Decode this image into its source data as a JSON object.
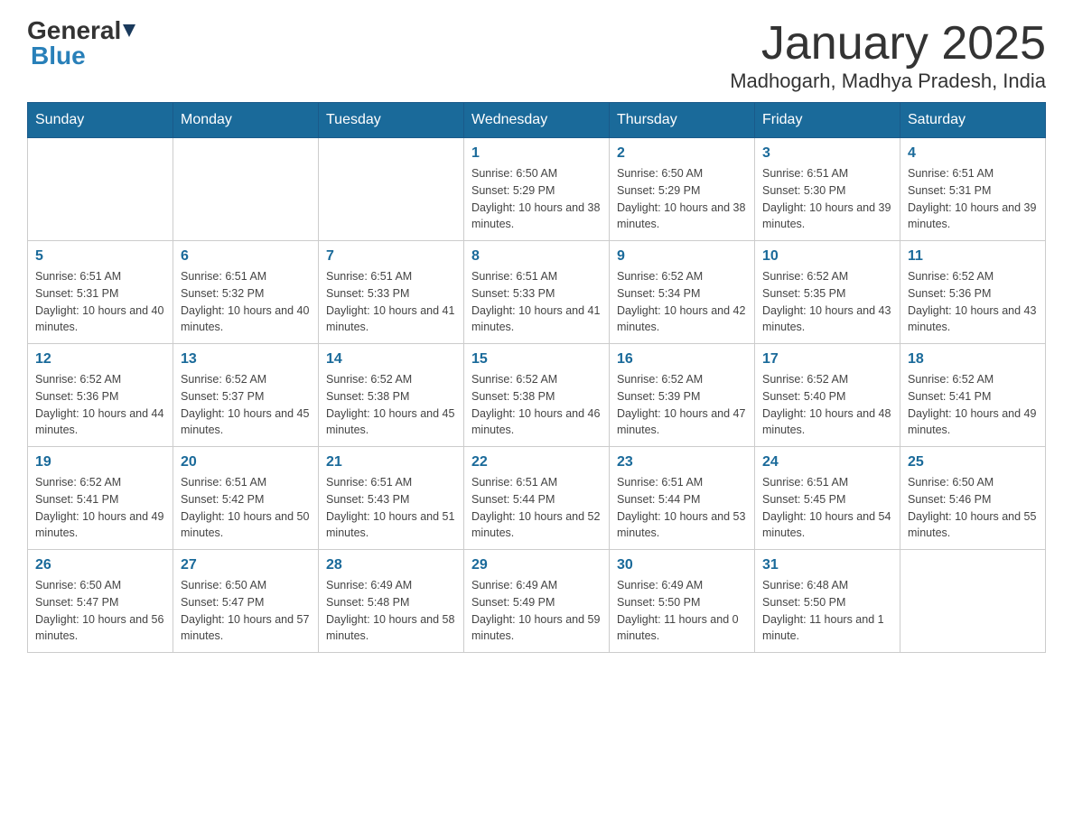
{
  "header": {
    "logo_general": "General",
    "logo_blue": "Blue",
    "title": "January 2025",
    "subtitle": "Madhogarh, Madhya Pradesh, India"
  },
  "weekdays": [
    "Sunday",
    "Monday",
    "Tuesday",
    "Wednesday",
    "Thursday",
    "Friday",
    "Saturday"
  ],
  "weeks": [
    [
      {
        "day": "",
        "sunrise": "",
        "sunset": "",
        "daylight": ""
      },
      {
        "day": "",
        "sunrise": "",
        "sunset": "",
        "daylight": ""
      },
      {
        "day": "",
        "sunrise": "",
        "sunset": "",
        "daylight": ""
      },
      {
        "day": "1",
        "sunrise": "Sunrise: 6:50 AM",
        "sunset": "Sunset: 5:29 PM",
        "daylight": "Daylight: 10 hours and 38 minutes."
      },
      {
        "day": "2",
        "sunrise": "Sunrise: 6:50 AM",
        "sunset": "Sunset: 5:29 PM",
        "daylight": "Daylight: 10 hours and 38 minutes."
      },
      {
        "day": "3",
        "sunrise": "Sunrise: 6:51 AM",
        "sunset": "Sunset: 5:30 PM",
        "daylight": "Daylight: 10 hours and 39 minutes."
      },
      {
        "day": "4",
        "sunrise": "Sunrise: 6:51 AM",
        "sunset": "Sunset: 5:31 PM",
        "daylight": "Daylight: 10 hours and 39 minutes."
      }
    ],
    [
      {
        "day": "5",
        "sunrise": "Sunrise: 6:51 AM",
        "sunset": "Sunset: 5:31 PM",
        "daylight": "Daylight: 10 hours and 40 minutes."
      },
      {
        "day": "6",
        "sunrise": "Sunrise: 6:51 AM",
        "sunset": "Sunset: 5:32 PM",
        "daylight": "Daylight: 10 hours and 40 minutes."
      },
      {
        "day": "7",
        "sunrise": "Sunrise: 6:51 AM",
        "sunset": "Sunset: 5:33 PM",
        "daylight": "Daylight: 10 hours and 41 minutes."
      },
      {
        "day": "8",
        "sunrise": "Sunrise: 6:51 AM",
        "sunset": "Sunset: 5:33 PM",
        "daylight": "Daylight: 10 hours and 41 minutes."
      },
      {
        "day": "9",
        "sunrise": "Sunrise: 6:52 AM",
        "sunset": "Sunset: 5:34 PM",
        "daylight": "Daylight: 10 hours and 42 minutes."
      },
      {
        "day": "10",
        "sunrise": "Sunrise: 6:52 AM",
        "sunset": "Sunset: 5:35 PM",
        "daylight": "Daylight: 10 hours and 43 minutes."
      },
      {
        "day": "11",
        "sunrise": "Sunrise: 6:52 AM",
        "sunset": "Sunset: 5:36 PM",
        "daylight": "Daylight: 10 hours and 43 minutes."
      }
    ],
    [
      {
        "day": "12",
        "sunrise": "Sunrise: 6:52 AM",
        "sunset": "Sunset: 5:36 PM",
        "daylight": "Daylight: 10 hours and 44 minutes."
      },
      {
        "day": "13",
        "sunrise": "Sunrise: 6:52 AM",
        "sunset": "Sunset: 5:37 PM",
        "daylight": "Daylight: 10 hours and 45 minutes."
      },
      {
        "day": "14",
        "sunrise": "Sunrise: 6:52 AM",
        "sunset": "Sunset: 5:38 PM",
        "daylight": "Daylight: 10 hours and 45 minutes."
      },
      {
        "day": "15",
        "sunrise": "Sunrise: 6:52 AM",
        "sunset": "Sunset: 5:38 PM",
        "daylight": "Daylight: 10 hours and 46 minutes."
      },
      {
        "day": "16",
        "sunrise": "Sunrise: 6:52 AM",
        "sunset": "Sunset: 5:39 PM",
        "daylight": "Daylight: 10 hours and 47 minutes."
      },
      {
        "day": "17",
        "sunrise": "Sunrise: 6:52 AM",
        "sunset": "Sunset: 5:40 PM",
        "daylight": "Daylight: 10 hours and 48 minutes."
      },
      {
        "day": "18",
        "sunrise": "Sunrise: 6:52 AM",
        "sunset": "Sunset: 5:41 PM",
        "daylight": "Daylight: 10 hours and 49 minutes."
      }
    ],
    [
      {
        "day": "19",
        "sunrise": "Sunrise: 6:52 AM",
        "sunset": "Sunset: 5:41 PM",
        "daylight": "Daylight: 10 hours and 49 minutes."
      },
      {
        "day": "20",
        "sunrise": "Sunrise: 6:51 AM",
        "sunset": "Sunset: 5:42 PM",
        "daylight": "Daylight: 10 hours and 50 minutes."
      },
      {
        "day": "21",
        "sunrise": "Sunrise: 6:51 AM",
        "sunset": "Sunset: 5:43 PM",
        "daylight": "Daylight: 10 hours and 51 minutes."
      },
      {
        "day": "22",
        "sunrise": "Sunrise: 6:51 AM",
        "sunset": "Sunset: 5:44 PM",
        "daylight": "Daylight: 10 hours and 52 minutes."
      },
      {
        "day": "23",
        "sunrise": "Sunrise: 6:51 AM",
        "sunset": "Sunset: 5:44 PM",
        "daylight": "Daylight: 10 hours and 53 minutes."
      },
      {
        "day": "24",
        "sunrise": "Sunrise: 6:51 AM",
        "sunset": "Sunset: 5:45 PM",
        "daylight": "Daylight: 10 hours and 54 minutes."
      },
      {
        "day": "25",
        "sunrise": "Sunrise: 6:50 AM",
        "sunset": "Sunset: 5:46 PM",
        "daylight": "Daylight: 10 hours and 55 minutes."
      }
    ],
    [
      {
        "day": "26",
        "sunrise": "Sunrise: 6:50 AM",
        "sunset": "Sunset: 5:47 PM",
        "daylight": "Daylight: 10 hours and 56 minutes."
      },
      {
        "day": "27",
        "sunrise": "Sunrise: 6:50 AM",
        "sunset": "Sunset: 5:47 PM",
        "daylight": "Daylight: 10 hours and 57 minutes."
      },
      {
        "day": "28",
        "sunrise": "Sunrise: 6:49 AM",
        "sunset": "Sunset: 5:48 PM",
        "daylight": "Daylight: 10 hours and 58 minutes."
      },
      {
        "day": "29",
        "sunrise": "Sunrise: 6:49 AM",
        "sunset": "Sunset: 5:49 PM",
        "daylight": "Daylight: 10 hours and 59 minutes."
      },
      {
        "day": "30",
        "sunrise": "Sunrise: 6:49 AM",
        "sunset": "Sunset: 5:50 PM",
        "daylight": "Daylight: 11 hours and 0 minutes."
      },
      {
        "day": "31",
        "sunrise": "Sunrise: 6:48 AM",
        "sunset": "Sunset: 5:50 PM",
        "daylight": "Daylight: 11 hours and 1 minute."
      },
      {
        "day": "",
        "sunrise": "",
        "sunset": "",
        "daylight": ""
      }
    ]
  ]
}
